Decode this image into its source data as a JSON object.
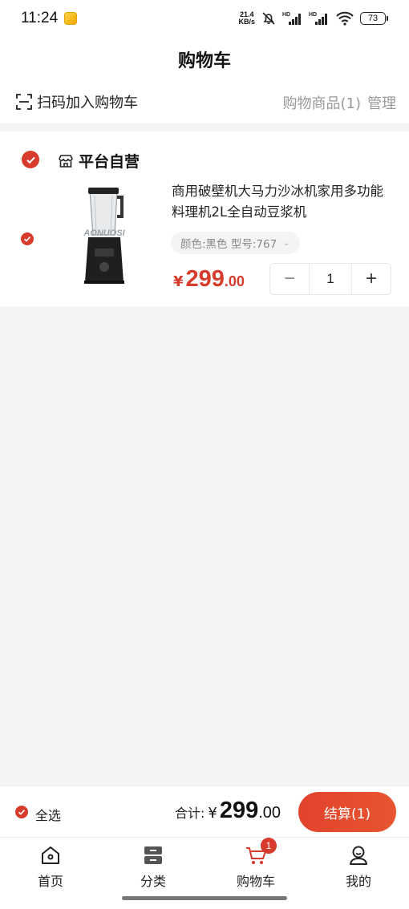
{
  "status": {
    "time": "11:24",
    "netspeed_value": "21.4",
    "netspeed_unit": "KB/s",
    "hd1": "HD",
    "hd2": "HD",
    "battery": "73"
  },
  "header": {
    "title": "购物车",
    "scan_label": "扫码加入购物车",
    "cart_goods_label": "购物商品(1)",
    "manage_label": "管理"
  },
  "store": {
    "name": "平台自营",
    "items": [
      {
        "title": "商用破壁机大马力沙冰机家用多功能料理机2L全自动豆浆机",
        "sku": "颜色:黑色  型号:767",
        "price_currency": "¥",
        "price_int": "299",
        "price_dec": ".00",
        "quantity": "1",
        "brand_text": "AONUOSI"
      }
    ]
  },
  "stepper": {
    "minus": "−",
    "plus": "+"
  },
  "checkout": {
    "select_all_label": "全选",
    "total_label": "合计:",
    "total_currency": "¥",
    "total_int": "299",
    "total_dec": ".00",
    "button_label": "结算(1)"
  },
  "tabs": [
    {
      "label": "首页",
      "icon": "home-icon"
    },
    {
      "label": "分类",
      "icon": "category-icon"
    },
    {
      "label": "购物车",
      "icon": "cart-icon",
      "badge": "1",
      "active": true
    },
    {
      "label": "我的",
      "icon": "profile-icon"
    }
  ],
  "colors": {
    "accent": "#d63b2b",
    "background": "#f4f4f4"
  }
}
